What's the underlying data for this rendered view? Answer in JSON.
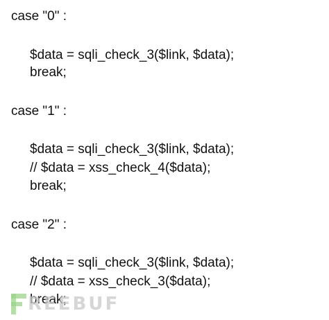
{
  "lines": [
    "case \"0\" :",
    "$data = sqli_check_3($link, $data);",
    "break;",
    "case \"1\" :",
    "$data = sqli_check_3($link, $data);",
    "// $data = xss_check_4($data);",
    "break;",
    "case \"2\" :",
    "$data = sqli_check_3($link, $data);",
    "// $data = xss_check_3($data);",
    "break;"
  ],
  "watermark": {
    "text": "REEBUF",
    "icon": "freebuf-logo-icon",
    "colors": {
      "icon": "#9bd48a",
      "text": "#c9c9c9"
    }
  },
  "colors": {
    "text": "#111111",
    "background": "#ffffff"
  }
}
